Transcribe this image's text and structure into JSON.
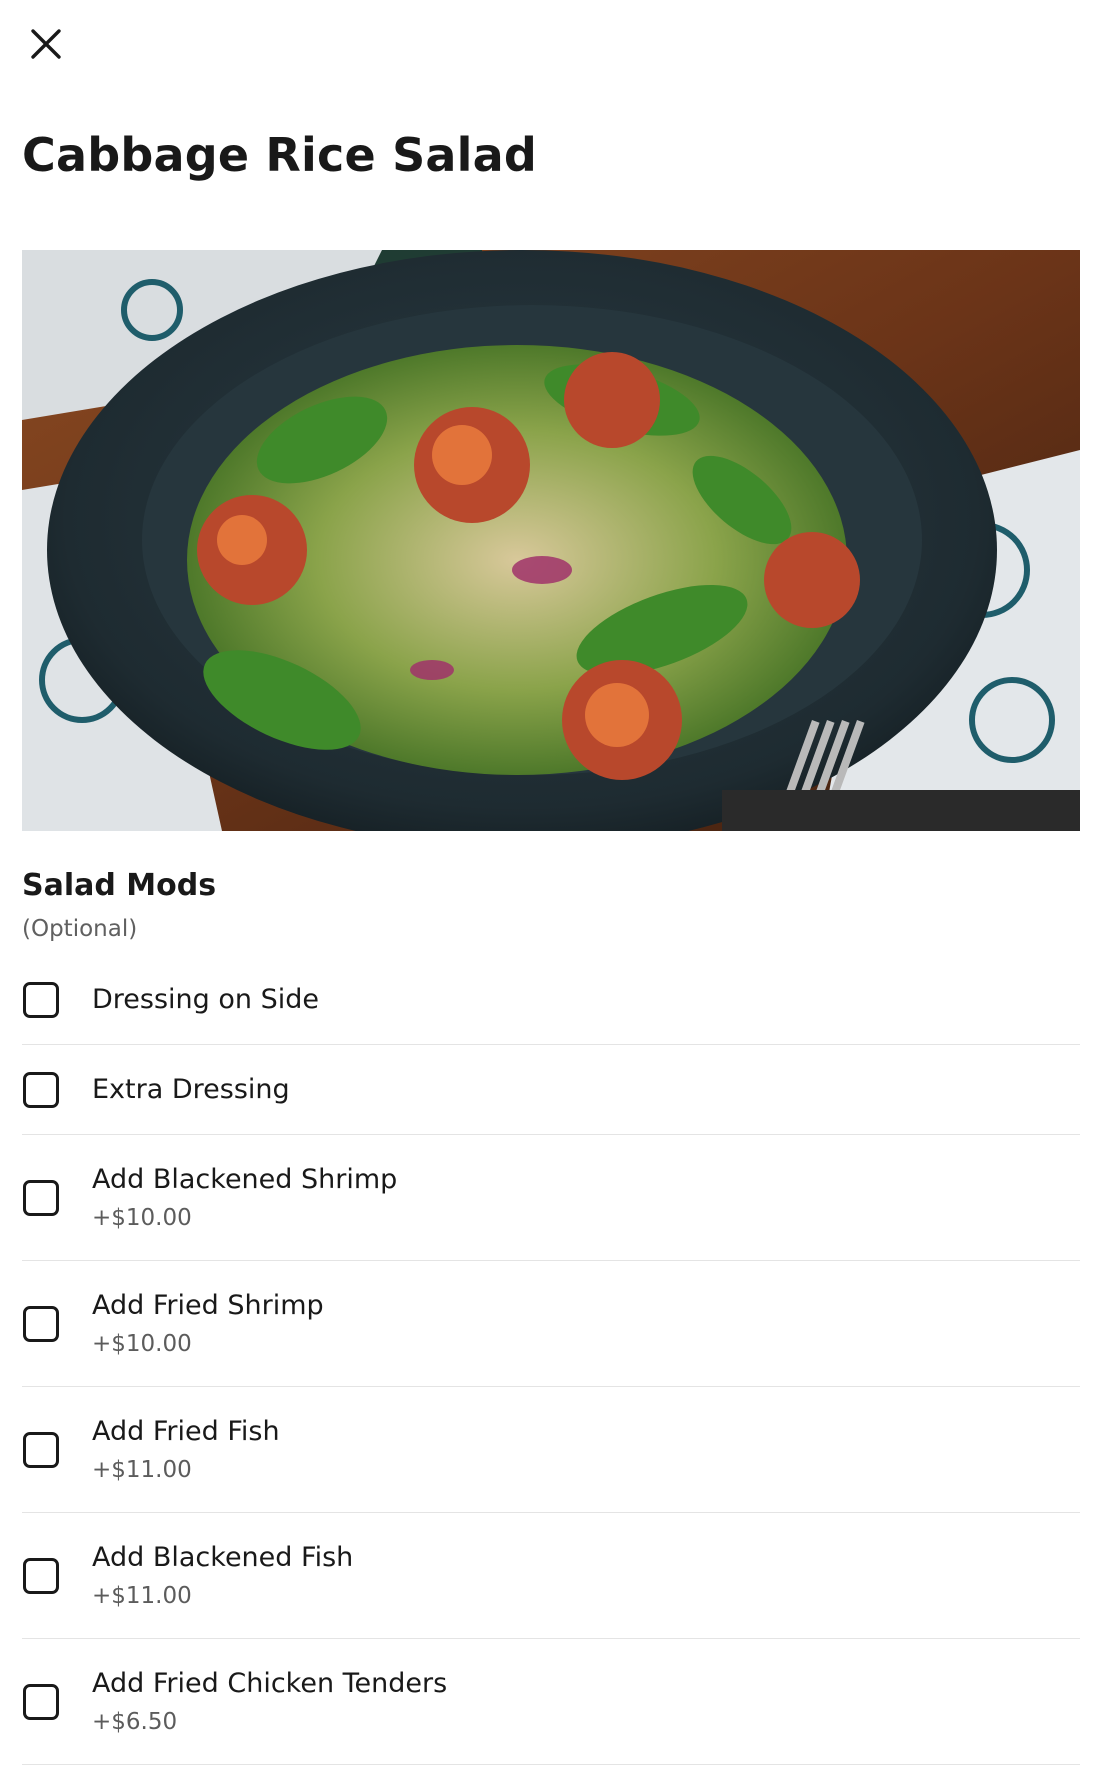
{
  "header": {
    "close_icon": "close-icon",
    "title": "Cabbage Rice Salad"
  },
  "hero": {
    "image": "salad-bowl-photo",
    "description_visible": false
  },
  "section": {
    "title": "Salad Mods",
    "subtitle": "(Optional)"
  },
  "options": [
    {
      "label": "Dressing on Side",
      "price": ""
    },
    {
      "label": "Extra Dressing",
      "price": ""
    },
    {
      "label": "Add Blackened Shrimp",
      "price": "+$10.00"
    },
    {
      "label": "Add Fried Shrimp",
      "price": "+$10.00"
    },
    {
      "label": "Add Fried Fish",
      "price": "+$11.00"
    },
    {
      "label": "Add Blackened Fish",
      "price": "+$11.00"
    },
    {
      "label": "Add Fried Chicken Tenders",
      "price": "+$6.50"
    }
  ],
  "colors": {
    "text": "#191919",
    "muted": "#606060",
    "divider": "#e4e4e4"
  }
}
